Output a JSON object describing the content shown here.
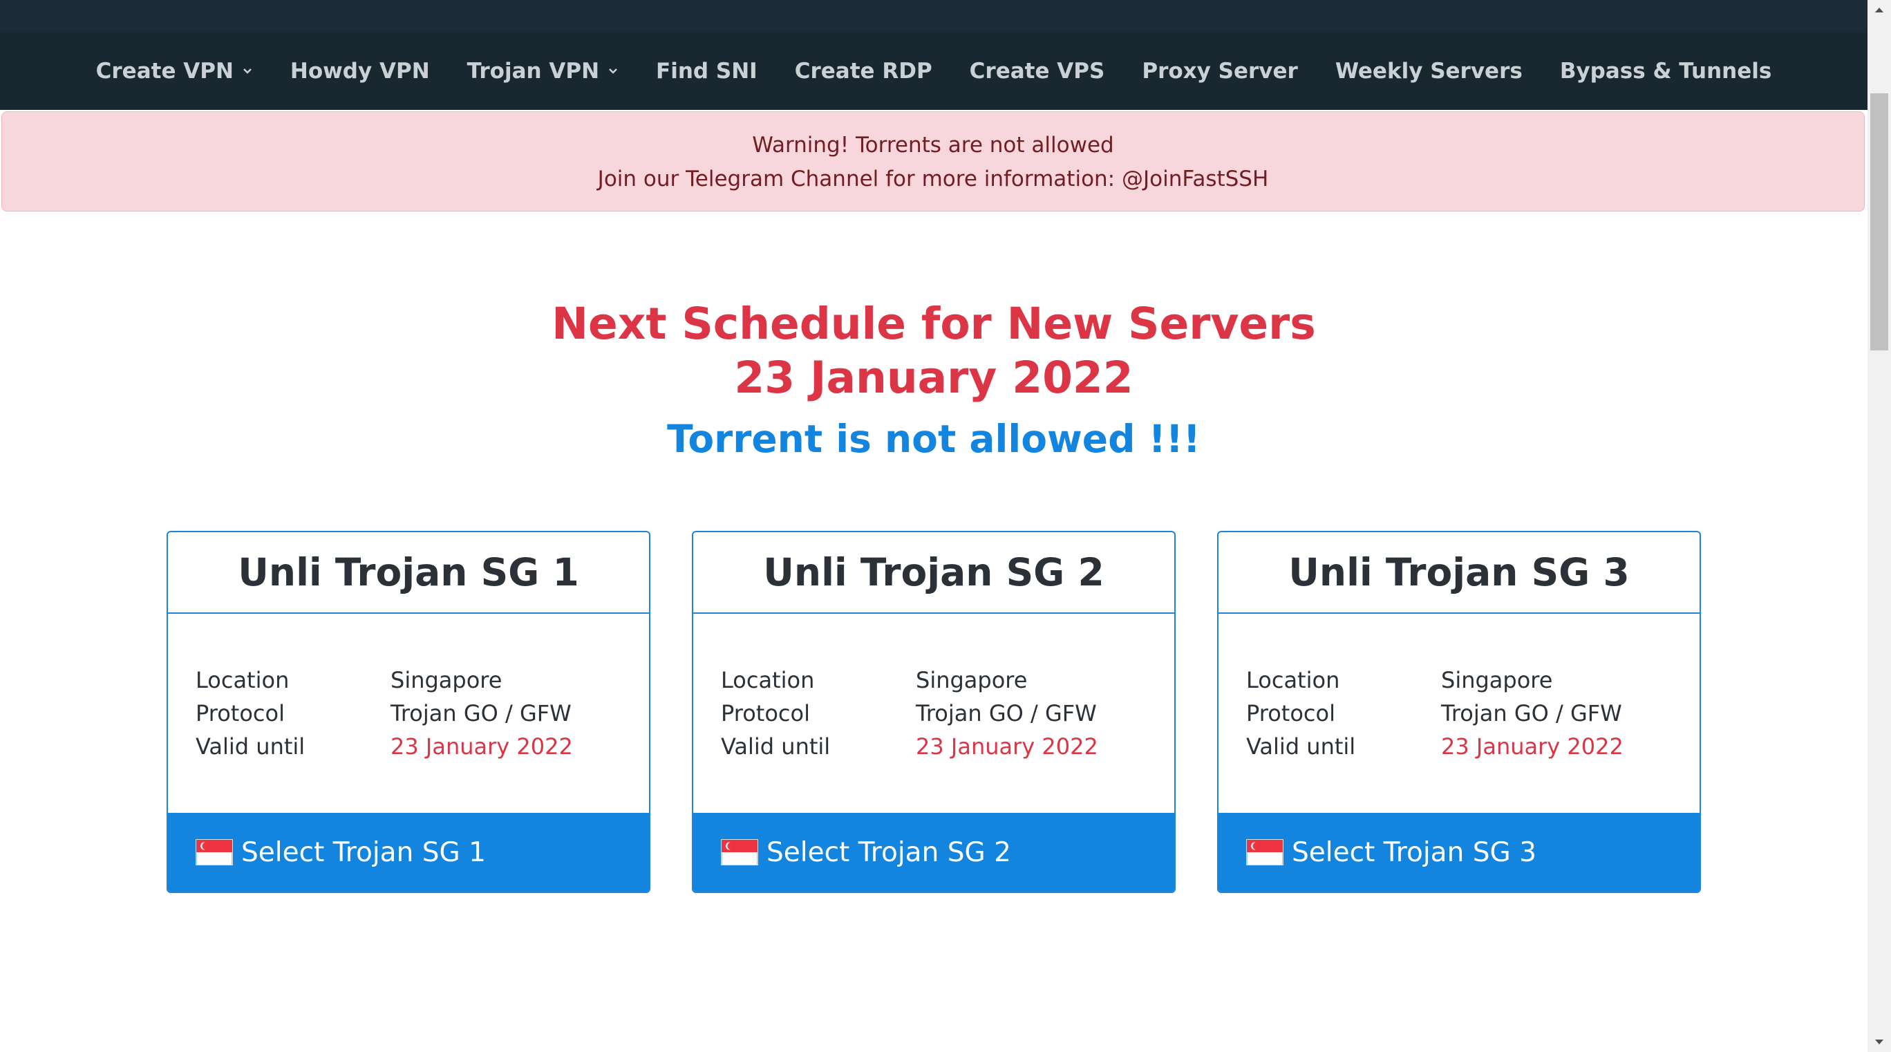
{
  "nav": {
    "items": [
      {
        "label": "Create VPN",
        "dropdown": true
      },
      {
        "label": "Howdy VPN",
        "dropdown": false
      },
      {
        "label": "Trojan VPN",
        "dropdown": true
      },
      {
        "label": "Find SNI",
        "dropdown": false
      },
      {
        "label": "Create RDP",
        "dropdown": false
      },
      {
        "label": "Create VPS",
        "dropdown": false
      },
      {
        "label": "Proxy Server",
        "dropdown": false
      },
      {
        "label": "Weekly Servers",
        "dropdown": false
      },
      {
        "label": "Bypass & Tunnels",
        "dropdown": false
      }
    ]
  },
  "alert": {
    "line1": "Warning! Torrents are not allowed",
    "line2": "Join our Telegram Channel for more information: @JoinFastSSH"
  },
  "schedule": {
    "title": "Next Schedule for New Servers",
    "date": "23 January 2022",
    "notice": "Torrent is not allowed !!!"
  },
  "cards": [
    {
      "title": "Unli Trojan SG 1",
      "location_label": "Location",
      "location": "Singapore",
      "protocol_label": "Protocol",
      "protocol": "Trojan GO / GFW",
      "valid_label": "Valid until",
      "valid": "23 January 2022",
      "button": "Select Trojan SG 1",
      "flag_icon": "singapore-flag-icon"
    },
    {
      "title": "Unli Trojan SG 2",
      "location_label": "Location",
      "location": "Singapore",
      "protocol_label": "Protocol",
      "protocol": "Trojan GO / GFW",
      "valid_label": "Valid until",
      "valid": "23 January 2022",
      "button": "Select Trojan SG 2",
      "flag_icon": "singapore-flag-icon"
    },
    {
      "title": "Unli Trojan SG 3",
      "location_label": "Location",
      "location": "Singapore",
      "protocol_label": "Protocol",
      "protocol": "Trojan GO / GFW",
      "valid_label": "Valid until",
      "valid": "23 January 2022",
      "button": "Select Trojan SG 3",
      "flag_icon": "singapore-flag-icon"
    }
  ],
  "colors": {
    "navbar": "#192830",
    "alert_bg": "#f8d7dc",
    "headline": "#dc3545",
    "accent_blue": "#1385de"
  }
}
